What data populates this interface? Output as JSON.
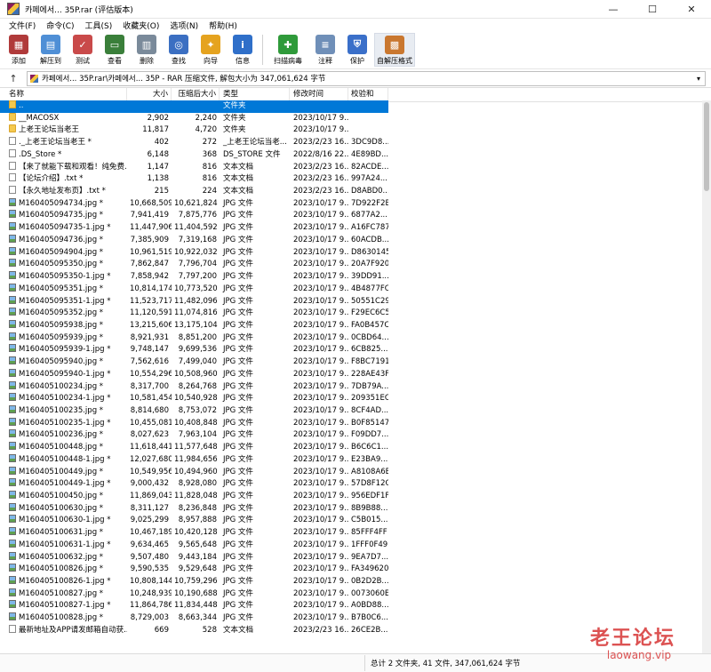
{
  "window": {
    "title": "카페에서... 35P.rar (评估版本)",
    "minimize": "—",
    "maximize": "☐",
    "close": "✕"
  },
  "menu": [
    "文件(F)",
    "命令(C)",
    "工具(S)",
    "收藏夹(O)",
    "选项(N)",
    "帮助(H)"
  ],
  "toolbar": [
    {
      "label": "添加",
      "icon": "add-archive-icon",
      "color": "#b03a3a",
      "glyph": "▦"
    },
    {
      "label": "解压到",
      "icon": "extract-folder-icon",
      "color": "#4f8fd6",
      "glyph": "▤"
    },
    {
      "label": "测试",
      "icon": "test-icon",
      "color": "#c94a4a",
      "glyph": "✓"
    },
    {
      "label": "查看",
      "icon": "view-book-icon",
      "color": "#3a7f3a",
      "glyph": "▭"
    },
    {
      "label": "删除",
      "icon": "trash-icon",
      "color": "#7a8a9a",
      "glyph": "▥"
    },
    {
      "label": "查找",
      "icon": "search-icon",
      "color": "#3b6fc2",
      "glyph": "◎"
    },
    {
      "label": "向导",
      "icon": "wizard-wand-icon",
      "color": "#e5a31f",
      "glyph": "✦"
    },
    {
      "label": "信息",
      "icon": "info-icon",
      "color": "#2f6fc9",
      "glyph": "i"
    },
    {
      "label": "扫描病毒",
      "icon": "virus-scan-icon",
      "color": "#2f9a3a",
      "glyph": "✚"
    },
    {
      "label": "注释",
      "icon": "comment-icon",
      "color": "#6f8fb8",
      "glyph": "≡"
    },
    {
      "label": "保护",
      "icon": "shield-icon",
      "color": "#3a6fc9",
      "glyph": "⛨"
    },
    {
      "label": "自解压格式",
      "icon": "sfx-box-icon",
      "color": "#c9772f",
      "glyph": "▩"
    }
  ],
  "address": {
    "up": "↑",
    "path": "카페에서... 35P.rar\\카페에서... 35P - RAR 压缩文件, 解包大小为 347,061,624 字节",
    "dropdown": "▾"
  },
  "columns": {
    "name": "名称",
    "size": "大小",
    "packed": "压缩后大小",
    "type": "类型",
    "modified": "修改时间",
    "crc": "校验和"
  },
  "files": [
    {
      "name": "..",
      "size": "",
      "packed": "",
      "type": "文件夹",
      "modified": "",
      "crc": "",
      "icon": "upfolder",
      "selected": true
    },
    {
      "name": "__MACOSX",
      "size": "2,902",
      "packed": "2,240",
      "type": "文件夹",
      "modified": "2023/10/17 9...",
      "crc": "",
      "icon": "folder"
    },
    {
      "name": "上老王论坛当老王",
      "size": "11,817",
      "packed": "4,720",
      "type": "文件夹",
      "modified": "2023/10/17 9...",
      "crc": "",
      "icon": "folder"
    },
    {
      "name": "._上老王论坛当老王 *",
      "size": "402",
      "packed": "272",
      "type": "_上老王论坛当老...",
      "modified": "2023/2/23 16...",
      "crc": "3DC9D8...",
      "icon": "file"
    },
    {
      "name": ".DS_Store *",
      "size": "6,148",
      "packed": "368",
      "type": "DS_STORE 文件",
      "modified": "2022/8/16 22...",
      "crc": "4E89BD...",
      "icon": "file"
    },
    {
      "name": "【来了就能下载和观看！纯免费...",
      "size": "1,147",
      "packed": "816",
      "type": "文本文档",
      "modified": "2023/2/23 16...",
      "crc": "82ACDE...",
      "icon": "file"
    },
    {
      "name": "【论坛介绍】.txt *",
      "size": "1,138",
      "packed": "816",
      "type": "文本文档",
      "modified": "2023/2/23 16...",
      "crc": "997A24...",
      "icon": "file"
    },
    {
      "name": "【永久地址发布页】.txt *",
      "size": "215",
      "packed": "224",
      "type": "文本文档",
      "modified": "2023/2/23 16...",
      "crc": "D8ABD0...",
      "icon": "file"
    },
    {
      "name": "M160405094734.jpg *",
      "size": "10,668,509",
      "packed": "10,621,824",
      "type": "JPG 文件",
      "modified": "2023/10/17 9...",
      "crc": "7D922F2B",
      "icon": "img"
    },
    {
      "name": "M160405094735.jpg *",
      "size": "7,941,419",
      "packed": "7,875,776",
      "type": "JPG 文件",
      "modified": "2023/10/17 9...",
      "crc": "6877A2...",
      "icon": "img"
    },
    {
      "name": "M160405094735-1.jpg *",
      "size": "11,447,906",
      "packed": "11,404,592",
      "type": "JPG 文件",
      "modified": "2023/10/17 9...",
      "crc": "A16FC787",
      "icon": "img"
    },
    {
      "name": "M160405094736.jpg *",
      "size": "7,385,909",
      "packed": "7,319,168",
      "type": "JPG 文件",
      "modified": "2023/10/17 9...",
      "crc": "60ACDB...",
      "icon": "img"
    },
    {
      "name": "M160405094904.jpg *",
      "size": "10,961,519",
      "packed": "10,922,032",
      "type": "JPG 文件",
      "modified": "2023/10/17 9...",
      "crc": "D8630145",
      "icon": "img"
    },
    {
      "name": "M160405095350.jpg *",
      "size": "7,862,847",
      "packed": "7,796,704",
      "type": "JPG 文件",
      "modified": "2023/10/17 9...",
      "crc": "20A7F920",
      "icon": "img"
    },
    {
      "name": "M160405095350-1.jpg *",
      "size": "7,858,942",
      "packed": "7,797,200",
      "type": "JPG 文件",
      "modified": "2023/10/17 9...",
      "crc": "39DD91...",
      "icon": "img"
    },
    {
      "name": "M160405095351.jpg *",
      "size": "10,814,174",
      "packed": "10,773,520",
      "type": "JPG 文件",
      "modified": "2023/10/17 9...",
      "crc": "4B4877FC",
      "icon": "img"
    },
    {
      "name": "M160405095351-1.jpg *",
      "size": "11,523,717",
      "packed": "11,482,096",
      "type": "JPG 文件",
      "modified": "2023/10/17 9...",
      "crc": "50551C29",
      "icon": "img"
    },
    {
      "name": "M160405095352.jpg *",
      "size": "11,120,591",
      "packed": "11,074,816",
      "type": "JPG 文件",
      "modified": "2023/10/17 9...",
      "crc": "F29EC6C5",
      "icon": "img"
    },
    {
      "name": "M160405095938.jpg *",
      "size": "13,215,606",
      "packed": "13,175,104",
      "type": "JPG 文件",
      "modified": "2023/10/17 9...",
      "crc": "FA0B457C",
      "icon": "img"
    },
    {
      "name": "M160405095939.jpg *",
      "size": "8,921,931",
      "packed": "8,851,200",
      "type": "JPG 文件",
      "modified": "2023/10/17 9...",
      "crc": "0CBD64...",
      "icon": "img"
    },
    {
      "name": "M160405095939-1.jpg *",
      "size": "9,748,147",
      "packed": "9,699,536",
      "type": "JPG 文件",
      "modified": "2023/10/17 9...",
      "crc": "6CB825...",
      "icon": "img"
    },
    {
      "name": "M160405095940.jpg *",
      "size": "7,562,616",
      "packed": "7,499,040",
      "type": "JPG 文件",
      "modified": "2023/10/17 9...",
      "crc": "F8BC7191",
      "icon": "img"
    },
    {
      "name": "M160405095940-1.jpg *",
      "size": "10,554,296",
      "packed": "10,508,960",
      "type": "JPG 文件",
      "modified": "2023/10/17 9...",
      "crc": "228AE43F",
      "icon": "img"
    },
    {
      "name": "M160405100234.jpg *",
      "size": "8,317,700",
      "packed": "8,264,768",
      "type": "JPG 文件",
      "modified": "2023/10/17 9...",
      "crc": "7DB79A...",
      "icon": "img"
    },
    {
      "name": "M160405100234-1.jpg *",
      "size": "10,581,454",
      "packed": "10,540,928",
      "type": "JPG 文件",
      "modified": "2023/10/17 9...",
      "crc": "209351EC",
      "icon": "img"
    },
    {
      "name": "M160405100235.jpg *",
      "size": "8,814,680",
      "packed": "8,753,072",
      "type": "JPG 文件",
      "modified": "2023/10/17 9...",
      "crc": "8CF4AD...",
      "icon": "img"
    },
    {
      "name": "M160405100235-1.jpg *",
      "size": "10,455,081",
      "packed": "10,408,848",
      "type": "JPG 文件",
      "modified": "2023/10/17 9...",
      "crc": "B0F85147",
      "icon": "img"
    },
    {
      "name": "M160405100236.jpg *",
      "size": "8,027,623",
      "packed": "7,963,104",
      "type": "JPG 文件",
      "modified": "2023/10/17 9...",
      "crc": "F09DD7...",
      "icon": "img"
    },
    {
      "name": "M160405100448.jpg *",
      "size": "11,618,441",
      "packed": "11,577,648",
      "type": "JPG 文件",
      "modified": "2023/10/17 9...",
      "crc": "B6C6C1...",
      "icon": "img"
    },
    {
      "name": "M160405100448-1.jpg *",
      "size": "12,027,680",
      "packed": "11,984,656",
      "type": "JPG 文件",
      "modified": "2023/10/17 9...",
      "crc": "E23BA9...",
      "icon": "img"
    },
    {
      "name": "M160405100449.jpg *",
      "size": "10,549,956",
      "packed": "10,494,960",
      "type": "JPG 文件",
      "modified": "2023/10/17 9...",
      "crc": "A8108A6E",
      "icon": "img"
    },
    {
      "name": "M160405100449-1.jpg *",
      "size": "9,000,432",
      "packed": "8,928,080",
      "type": "JPG 文件",
      "modified": "2023/10/17 9...",
      "crc": "57D8F12C",
      "icon": "img"
    },
    {
      "name": "M160405100450.jpg *",
      "size": "11,869,043",
      "packed": "11,828,048",
      "type": "JPG 文件",
      "modified": "2023/10/17 9...",
      "crc": "956EDF1F",
      "icon": "img"
    },
    {
      "name": "M160405100630.jpg *",
      "size": "8,311,127",
      "packed": "8,236,848",
      "type": "JPG 文件",
      "modified": "2023/10/17 9...",
      "crc": "8B9B88...",
      "icon": "img"
    },
    {
      "name": "M160405100630-1.jpg *",
      "size": "9,025,299",
      "packed": "8,957,888",
      "type": "JPG 文件",
      "modified": "2023/10/17 9...",
      "crc": "C5B015...",
      "icon": "img"
    },
    {
      "name": "M160405100631.jpg *",
      "size": "10,467,189",
      "packed": "10,420,128",
      "type": "JPG 文件",
      "modified": "2023/10/17 9...",
      "crc": "85FFF4FF",
      "icon": "img"
    },
    {
      "name": "M160405100631-1.jpg *",
      "size": "9,634,465",
      "packed": "9,565,648",
      "type": "JPG 文件",
      "modified": "2023/10/17 9...",
      "crc": "1FFF0F49",
      "icon": "img"
    },
    {
      "name": "M160405100632.jpg *",
      "size": "9,507,480",
      "packed": "9,443,184",
      "type": "JPG 文件",
      "modified": "2023/10/17 9...",
      "crc": "9EA7D7...",
      "icon": "img"
    },
    {
      "name": "M160405100826.jpg *",
      "size": "9,590,535",
      "packed": "9,529,648",
      "type": "JPG 文件",
      "modified": "2023/10/17 9...",
      "crc": "FA349620",
      "icon": "img"
    },
    {
      "name": "M160405100826-1.jpg *",
      "size": "10,808,144",
      "packed": "10,759,296",
      "type": "JPG 文件",
      "modified": "2023/10/17 9...",
      "crc": "0B2D2B...",
      "icon": "img"
    },
    {
      "name": "M160405100827.jpg *",
      "size": "10,248,939",
      "packed": "10,190,688",
      "type": "JPG 文件",
      "modified": "2023/10/17 9...",
      "crc": "0073060E",
      "icon": "img"
    },
    {
      "name": "M160405100827-1.jpg *",
      "size": "11,864,786",
      "packed": "11,834,448",
      "type": "JPG 文件",
      "modified": "2023/10/17 9...",
      "crc": "A0BD88...",
      "icon": "img"
    },
    {
      "name": "M160405100828.jpg *",
      "size": "8,729,003",
      "packed": "8,663,344",
      "type": "JPG 文件",
      "modified": "2023/10/17 9...",
      "crc": "B7B0C6...",
      "icon": "img"
    },
    {
      "name": "最新地址及APP请发邮箱自动获...",
      "size": "669",
      "packed": "528",
      "type": "文本文档",
      "modified": "2023/2/23 16...",
      "crc": "26CE2B...",
      "icon": "file"
    }
  ],
  "status": {
    "summary": "总计 2 文件夹, 41 文件, 347,061,624 字节"
  },
  "watermark": {
    "line1": "老王论坛",
    "line2": "laowang.vip"
  }
}
